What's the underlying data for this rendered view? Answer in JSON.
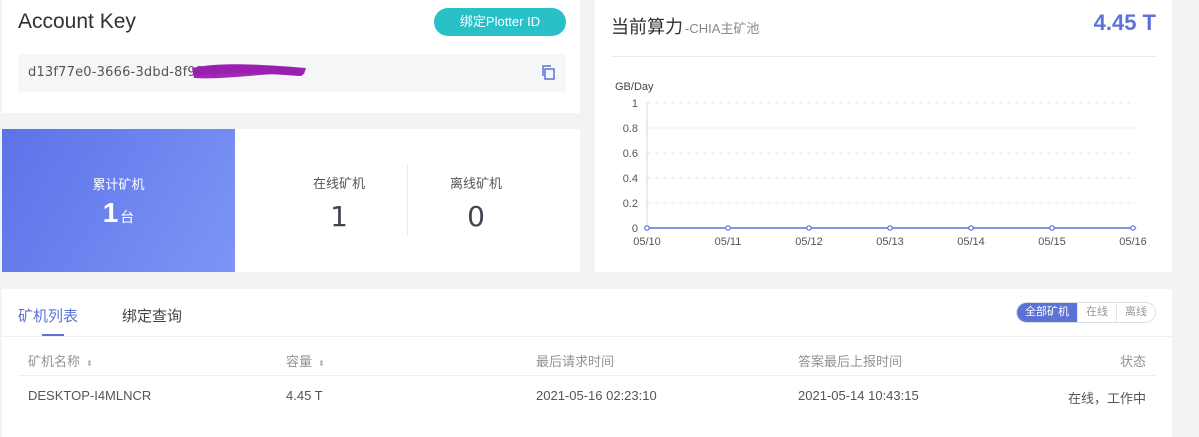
{
  "account": {
    "title": "Account Key",
    "bind_button": "绑定Plotter ID",
    "key_visible": "d13f77e0-3666-3dbd-8f93-8",
    "redaction_color": "#9b1fae"
  },
  "stats": {
    "total_label": "累计矿机",
    "total_value": "1",
    "total_unit": "台",
    "online_label": "在线矿机",
    "online_value": "1",
    "offline_label": "离线矿机",
    "offline_value": "0"
  },
  "power": {
    "title": "当前算力",
    "subtitle": "-CHIA主矿池",
    "value": "4.45 T"
  },
  "chart_data": {
    "type": "line",
    "ylabel": "GB/Day",
    "x": [
      "05/10",
      "05/11",
      "05/12",
      "05/13",
      "05/14",
      "05/15",
      "05/16"
    ],
    "y_ticks": [
      "0",
      "0.2",
      "0.4",
      "0.6",
      "0.8",
      "1"
    ],
    "ylim": [
      0,
      1
    ],
    "series": [
      {
        "values": [
          0,
          0,
          0,
          0,
          0,
          0,
          0
        ]
      }
    ],
    "grid": true,
    "color": "#5b73d6"
  },
  "list": {
    "tabs": [
      "矿机列表",
      "绑定查询"
    ],
    "filters": [
      "全部矿机",
      "在线",
      "离线"
    ],
    "columns": [
      "矿机名称",
      "容量",
      "最后请求时间",
      "答案最后上报时间",
      "状态"
    ],
    "sort_glyph": "⬍",
    "rows": [
      [
        "DESKTOP-I4MLNCR",
        "4.45 T",
        "2021-05-16 02:23:10",
        "2021-05-14 10:43:15",
        "在线，工作中"
      ]
    ]
  }
}
